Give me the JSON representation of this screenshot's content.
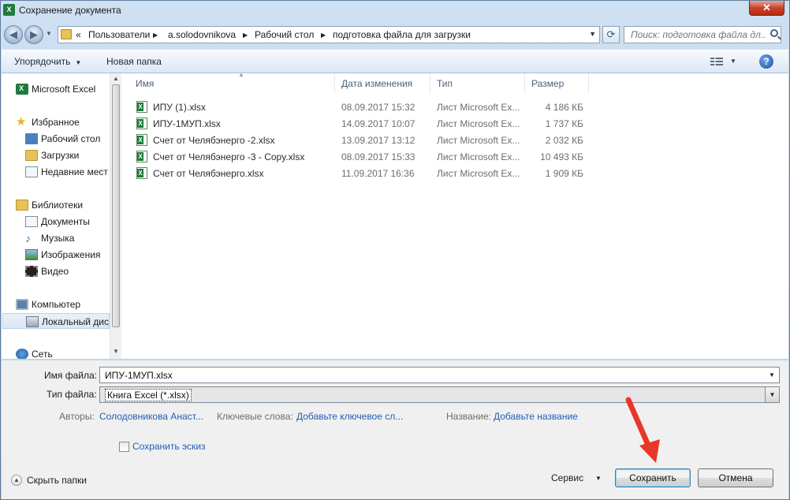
{
  "window": {
    "title": "Сохранение документа",
    "close_label": "✕"
  },
  "address": {
    "overflow": "«",
    "crumbs": [
      "Пользователи",
      "a.solodovnikova",
      "Рабочий стол",
      "подготовка файла для загрузки"
    ],
    "separator": "▶",
    "search_placeholder": "Поиск: подготовка файла дл..."
  },
  "toolbar": {
    "organize": "Упорядочить",
    "new_folder": "Новая папка",
    "help": "?"
  },
  "nav": {
    "excel": "Microsoft Excel",
    "favorites": "Избранное",
    "desktop": "Рабочий стол",
    "downloads": "Загрузки",
    "recent": "Недавние мест",
    "libraries": "Библиотеки",
    "documents": "Документы",
    "music": "Музыка",
    "pictures": "Изображения",
    "video": "Видео",
    "computer": "Компьютер",
    "local_disk": "Локальный дис",
    "network": "Сеть"
  },
  "columns": {
    "name": "Имя",
    "date": "Дата изменения",
    "type": "Тип",
    "size": "Размер"
  },
  "files": [
    {
      "name": "ИПУ (1).xlsx",
      "date": "08.09.2017 15:32",
      "type": "Лист Microsoft Ex...",
      "size": "4 186 КБ"
    },
    {
      "name": "ИПУ-1МУП.xlsx",
      "date": "14.09.2017 10:07",
      "type": "Лист Microsoft Ex...",
      "size": "1 737 КБ"
    },
    {
      "name": "Счет от Челябэнерго -2.xlsx",
      "date": "13.09.2017 13:12",
      "type": "Лист Microsoft Ex...",
      "size": "2 032 КБ"
    },
    {
      "name": "Счет от Челябэнерго -3 - Copy.xlsx",
      "date": "08.09.2017 15:33",
      "type": "Лист Microsoft Ex...",
      "size": "10 493 КБ"
    },
    {
      "name": "Счет от Челябэнерго.xlsx",
      "date": "11.09.2017 16:36",
      "type": "Лист Microsoft Ex...",
      "size": "1 909 КБ"
    }
  ],
  "form": {
    "filename_label": "Имя файла:",
    "filename_value": "ИПУ-1МУП.xlsx",
    "filetype_label": "Тип файла:",
    "filetype_value": "Книга Excel (*.xlsx)",
    "authors_label": "Авторы:",
    "authors_value": "Солодовникова Анаст...",
    "tags_label": "Ключевые слова:",
    "tags_value": "Добавьте ключевое сл...",
    "title_label": "Название:",
    "title_value": "Добавьте название",
    "thumbnail_label": "Сохранить эскиз",
    "hide_folders": "Скрыть папки",
    "service": "Сервис",
    "save": "Сохранить",
    "cancel": "Отмена"
  }
}
